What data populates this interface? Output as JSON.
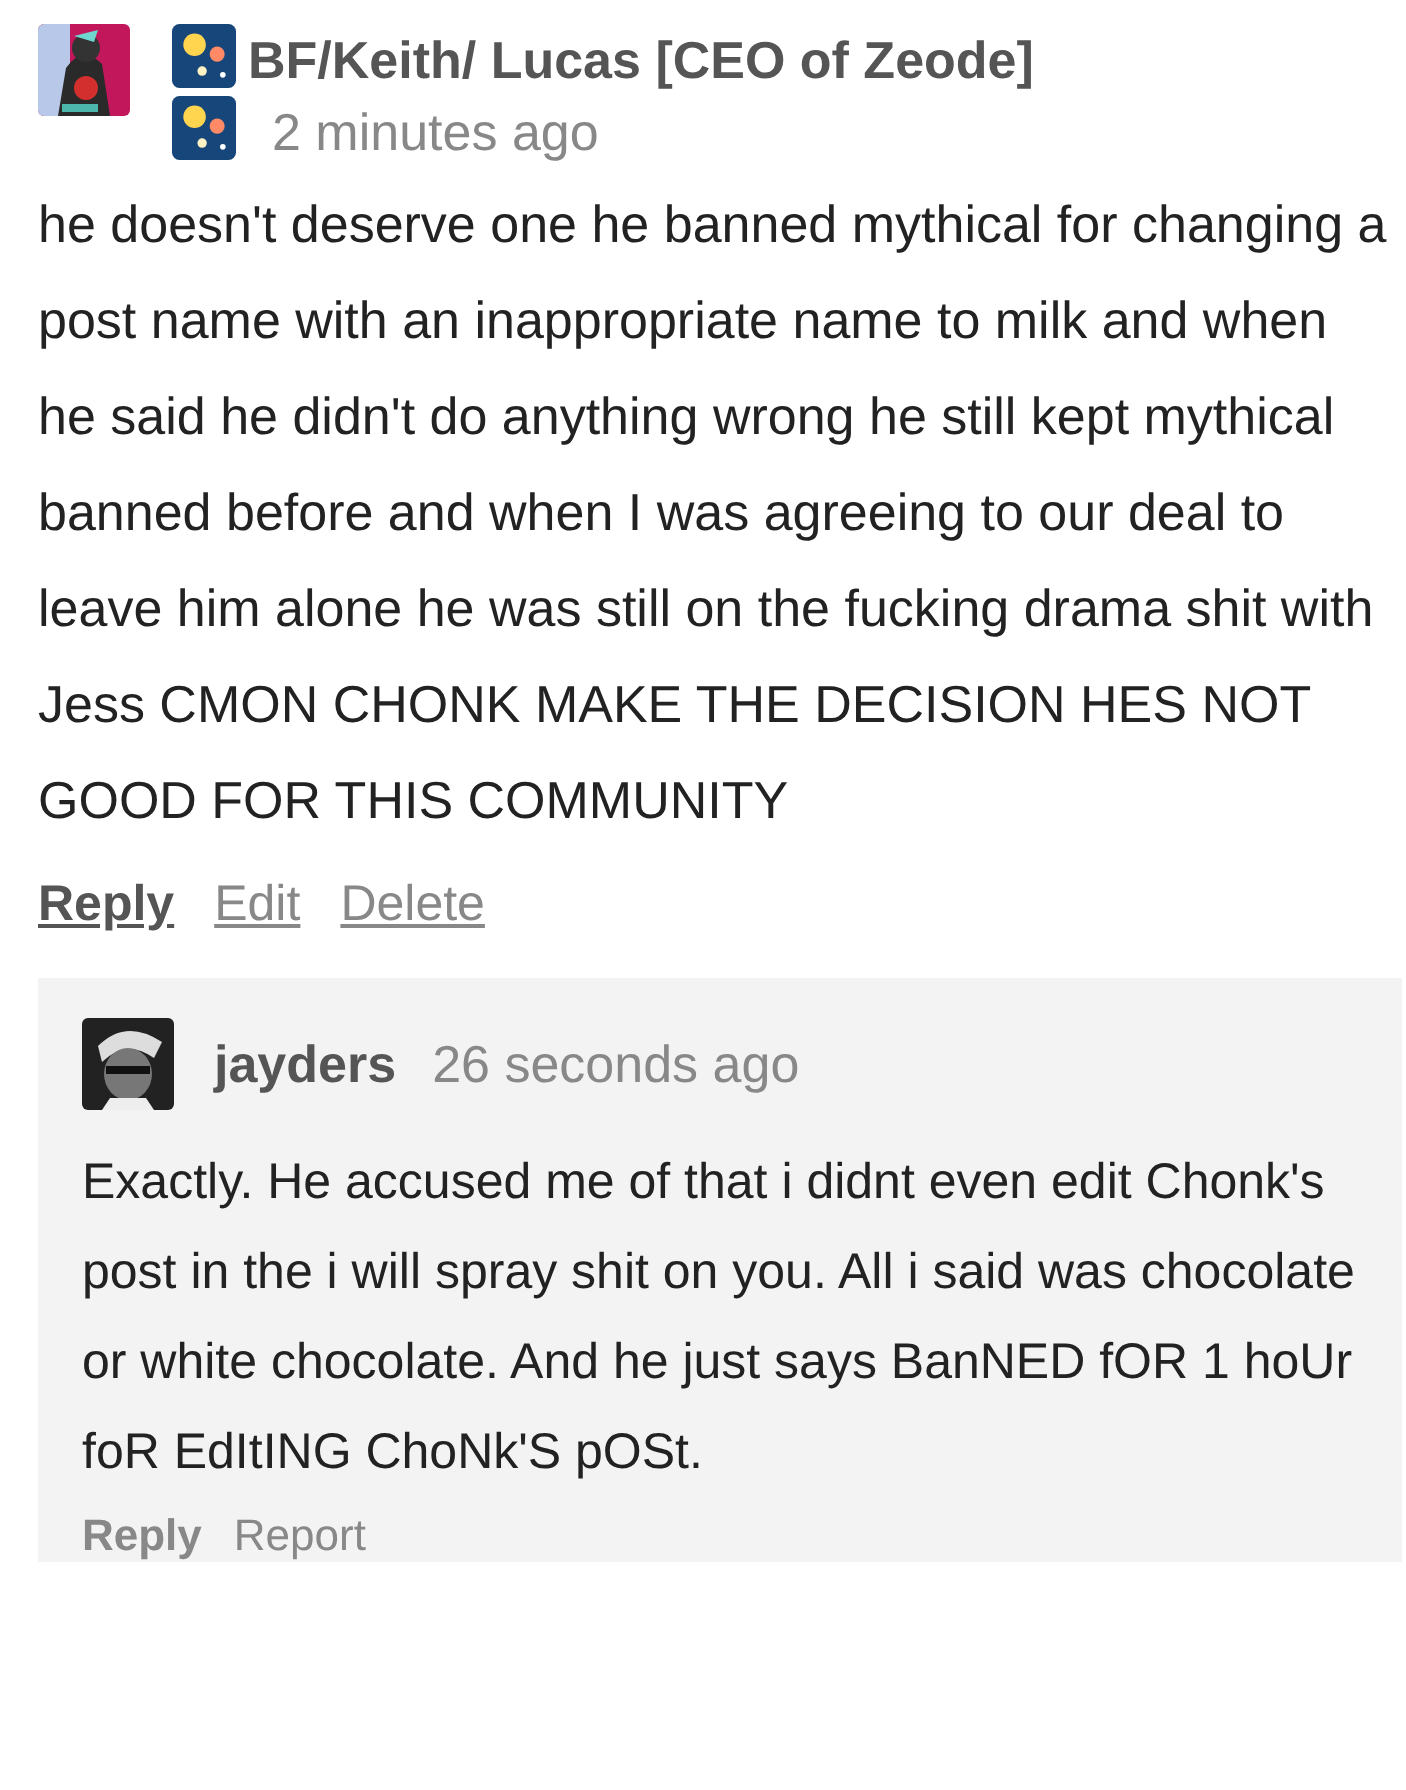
{
  "comment": {
    "author": "BF/Keith/ Lucas [CEO of Zeode]",
    "time": "2 minutes ago",
    "body": "he doesn't deserve one he banned mythical for changing a post name with an inappropriate name to milk and when he said he didn't do anything wrong he still kept mythical banned before and when I was agreeing to our deal to leave him alone he was still on the fucking drama shit with Jess CMON CHONK MAKE THE DECISION HES NOT GOOD FOR THIS COMMUNITY",
    "actions": [
      {
        "label": "Reply",
        "kind": "primary"
      },
      {
        "label": "Edit",
        "kind": "secondary"
      },
      {
        "label": "Delete",
        "kind": "secondary"
      }
    ]
  },
  "reply": {
    "author": "jayders",
    "time": "26 seconds ago",
    "body": "Exactly. He accused me of that i didnt even edit Chonk's post in the i will spray shit on you. All i said was chocolate or white chocolate. And he just says BanNED fOR 1 hoUr foR EdItING ChoNk'S pOSt.",
    "actions": [
      {
        "label": "Reply",
        "kind": "primary"
      },
      {
        "label": "Report",
        "kind": "secondary"
      }
    ]
  }
}
